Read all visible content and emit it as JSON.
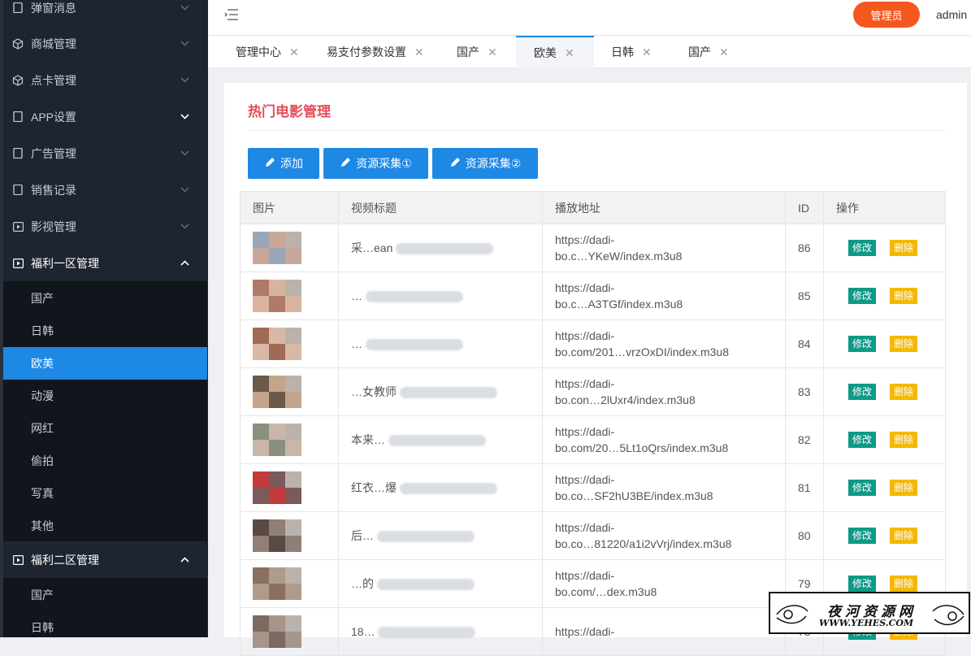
{
  "sidebar": {
    "items": [
      {
        "label": "弹窗消息",
        "icon": "document-icon"
      },
      {
        "label": "商城管理",
        "icon": "cube-icon"
      },
      {
        "label": "点卡管理",
        "icon": "cube-icon"
      },
      {
        "label": "APP设置",
        "icon": "document-icon"
      },
      {
        "label": "广告管理",
        "icon": "document-icon"
      },
      {
        "label": "销售记录",
        "icon": "document-icon"
      },
      {
        "label": "影视管理",
        "icon": "play-icon"
      },
      {
        "label": "福利一区管理",
        "icon": "play-icon"
      },
      {
        "label": "福利二区管理",
        "icon": "play-icon"
      }
    ],
    "group1_subitems": [
      "国产",
      "日韩",
      "欧美",
      "动漫",
      "网红",
      "偷拍",
      "写真",
      "其他"
    ],
    "group2_subitems": [
      "国产",
      "日韩"
    ],
    "active_subitem": "欧美"
  },
  "header": {
    "role_label": "管理员",
    "username": "admin"
  },
  "tabs": [
    {
      "label": "管理中心"
    },
    {
      "label": "易支付参数设置"
    },
    {
      "label": "国产"
    },
    {
      "label": "欧美",
      "active": true
    },
    {
      "label": "日韩"
    },
    {
      "label": "国产"
    }
  ],
  "panel": {
    "title": "热门电影管理",
    "buttons": [
      "添加",
      "资源采集①",
      "资源采集②"
    ]
  },
  "table": {
    "columns": [
      "图片",
      "视频标题",
      "播放地址",
      "ID",
      "操作"
    ],
    "edit_label": "修改",
    "delete_label": "删除",
    "rows": [
      {
        "title": "采…ean",
        "url1": "https://dadi-",
        "url2": "bo.c…YKeW/index.m3u8",
        "id": "86"
      },
      {
        "title": "…",
        "url1": "https://dadi-",
        "url2": "bo.c…A3TGf/index.m3u8",
        "id": "85"
      },
      {
        "title": "…",
        "url1": "https://dadi-",
        "url2": "bo.com/201…vrzOxDI/index.m3u8",
        "id": "84"
      },
      {
        "title": "…女教师",
        "url1": "https://dadi-",
        "url2": "bo.con…2lUxr4/index.m3u8",
        "id": "83"
      },
      {
        "title": "本来…",
        "url1": "https://dadi-",
        "url2": "bo.com/20…5Lt1oQrs/index.m3u8",
        "id": "82"
      },
      {
        "title": "红衣…爆",
        "url1": "https://dadi-",
        "url2": "bo.co…SF2hU3BE/index.m3u8",
        "id": "81"
      },
      {
        "title": "后…",
        "url1": "https://dadi-",
        "url2": "bo.co…81220/a1i2vVrj/index.m3u8",
        "id": "80"
      },
      {
        "title": "…的",
        "url1": "https://dadi-",
        "url2": "bo.com/…dex.m3u8",
        "id": "79"
      },
      {
        "title": "18…",
        "url1": "https://dadi-",
        "url2": "",
        "id": "78"
      }
    ]
  },
  "watermark": {
    "title": "夜河资源网",
    "url": "WWW.YEHES.COM"
  }
}
